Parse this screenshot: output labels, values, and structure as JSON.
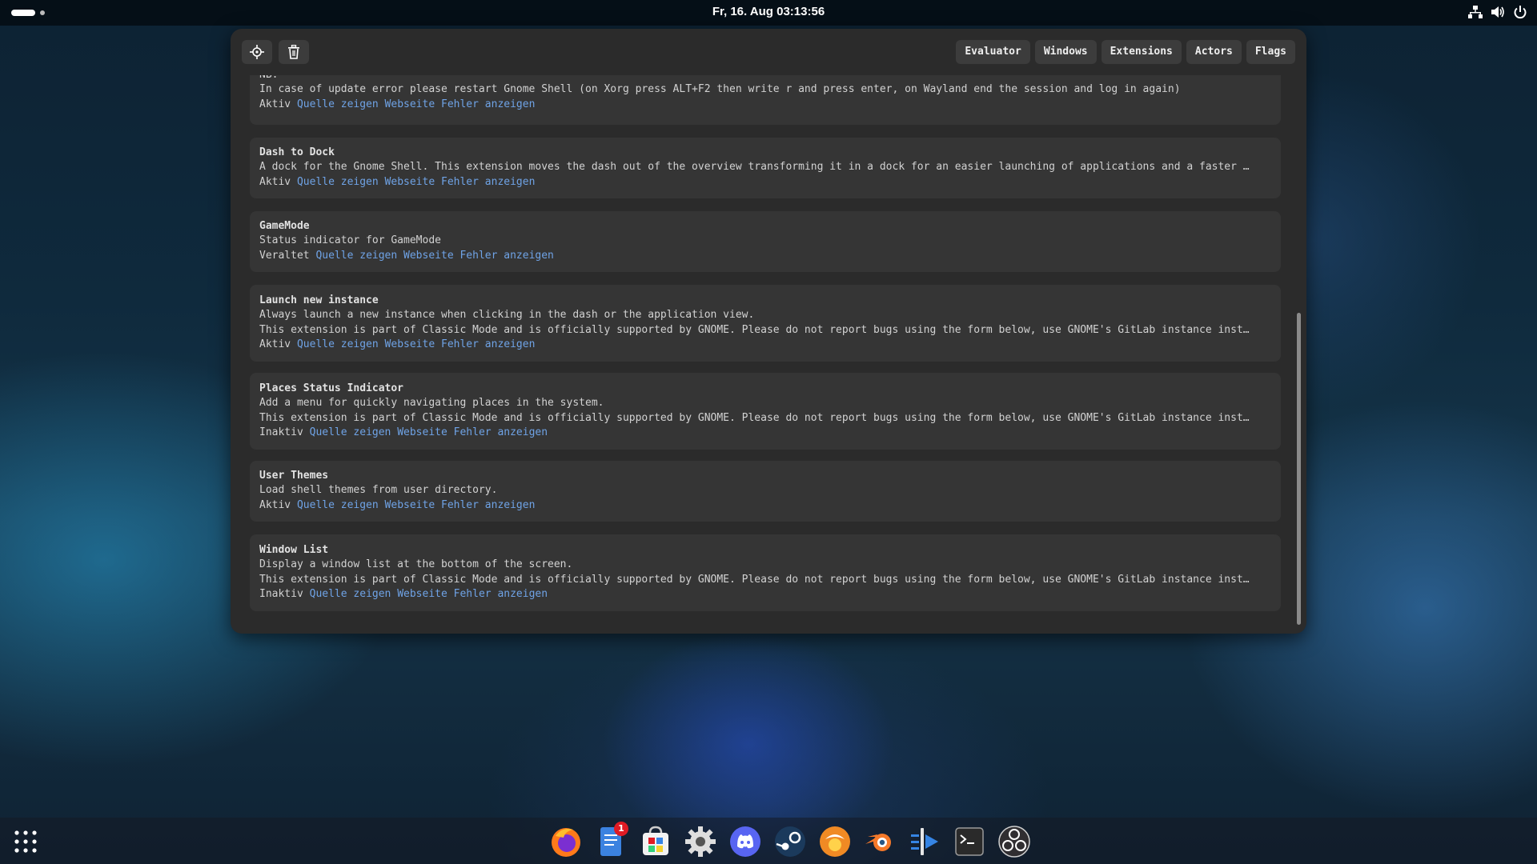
{
  "top_bar": {
    "clock": "Fr, 16. Aug  03:13:56",
    "tray_icons": [
      "network-icon",
      "volume-icon",
      "power-icon"
    ]
  },
  "looking_glass": {
    "toolbar_icons": [
      "picker-icon",
      "trash-icon"
    ],
    "tabs": [
      {
        "label": "Evaluator"
      },
      {
        "label": "Windows"
      },
      {
        "label": "Extensions"
      },
      {
        "label": "Actors"
      },
      {
        "label": "Flags"
      }
    ],
    "link_labels": {
      "source": "Quelle zeigen",
      "website": "Webseite",
      "errors": "Fehler anzeigen"
    },
    "extensions": [
      {
        "lines": [
          "NB:",
          "In case of update error please restart Gnome Shell (on Xorg press ALT+F2 then write r and press enter, on Wayland end the session and log in again)"
        ],
        "status": "Aktiv"
      },
      {
        "name": "Dash to Dock",
        "lines": [
          "A dock for the Gnome Shell. This extension moves the dash out of the overview transforming it in a dock for an easier launching of applications and a faster …"
        ],
        "status": "Aktiv"
      },
      {
        "name": "GameMode",
        "lines": [
          "Status indicator for GameMode"
        ],
        "status": "Veraltet"
      },
      {
        "name": "Launch new instance",
        "lines": [
          "Always launch a new instance when clicking in the dash or the application view.",
          "This extension is part of Classic Mode and is officially supported by GNOME. Please do not report bugs using the form below, use GNOME's GitLab instance inst…"
        ],
        "status": "Aktiv"
      },
      {
        "name": "Places Status Indicator",
        "lines": [
          "Add a menu for quickly navigating places in the system.",
          "This extension is part of Classic Mode and is officially supported by GNOME. Please do not report bugs using the form below, use GNOME's GitLab instance inst…"
        ],
        "status": "Inaktiv"
      },
      {
        "name": "User Themes",
        "lines": [
          "Load shell themes from user directory."
        ],
        "status": "Aktiv"
      },
      {
        "name": "Window List",
        "lines": [
          "Display a window list at the bottom of the screen.",
          "This extension is part of Classic Mode and is officially supported by GNOME. Please do not report bugs using the form below, use GNOME's GitLab instance inst…"
        ],
        "status": "Inaktiv"
      }
    ]
  },
  "dock": {
    "apps": [
      {
        "name": "firefox"
      },
      {
        "name": "notes",
        "badge": "1"
      },
      {
        "name": "software-store"
      },
      {
        "name": "settings"
      },
      {
        "name": "discord"
      },
      {
        "name": "steam"
      },
      {
        "name": "heroic-launcher"
      },
      {
        "name": "blender"
      },
      {
        "name": "text-editor"
      },
      {
        "name": "terminal"
      },
      {
        "name": "obs-studio"
      }
    ]
  },
  "colors": {
    "window_bg": "#2b2b2b",
    "card_bg": "#353535",
    "link": "#6fa3e6",
    "badge": "#e01b24"
  }
}
